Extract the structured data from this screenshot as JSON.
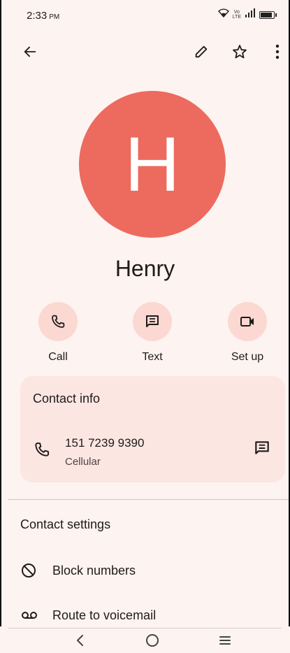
{
  "status_bar": {
    "time": "2:33",
    "period": "PM",
    "network_top": "Vo",
    "network_bottom": "LTE",
    "icons": [
      "wifi-icon",
      "signal-icon",
      "battery-icon"
    ]
  },
  "top_bar": {
    "icons": [
      "back-arrow-icon",
      "edit-pencil-icon",
      "star-outline-icon",
      "more-vert-icon"
    ]
  },
  "contact": {
    "initial": "H",
    "name": "Henry",
    "avatar_color": "#ed6a5e"
  },
  "actions": [
    {
      "label": "Call",
      "icon": "phone-icon"
    },
    {
      "label": "Text",
      "icon": "message-icon"
    },
    {
      "label": "Set up",
      "icon": "video-icon"
    }
  ],
  "contact_info": {
    "title": "Contact info",
    "phone": {
      "number": "151 7239 9390",
      "type": "Cellular"
    }
  },
  "contact_settings": {
    "title": "Contact settings",
    "items": [
      {
        "label": "Block numbers",
        "icon": "block-icon"
      },
      {
        "label": "Route to voicemail",
        "icon": "voicemail-icon"
      }
    ]
  },
  "nav_bar": {
    "icons": [
      "nav-back-icon",
      "nav-home-icon",
      "nav-recents-icon"
    ]
  },
  "colors": {
    "background": "#fdf3f0",
    "accent_soft": "#fcd8d2",
    "card": "#fbe6e2"
  }
}
